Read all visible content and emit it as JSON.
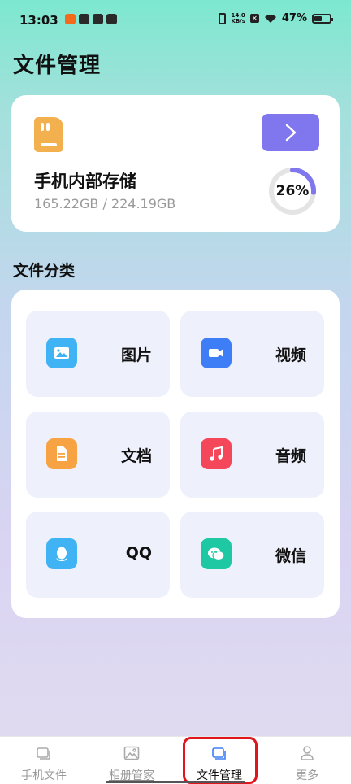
{
  "status_bar": {
    "time": "13:03",
    "net_speed_value": "14.0",
    "net_speed_unit": "KB/s",
    "battery": "47%"
  },
  "page_title": "文件管理",
  "storage": {
    "name": "手机内部存储",
    "size": "165.22GB / 224.19GB",
    "percent_label": "26%",
    "percent_value": 0.26,
    "accent_color": "#8076ee"
  },
  "categories_title": "文件分类",
  "categories": [
    {
      "label": "图片",
      "icon": "image-icon",
      "color": "#3fb3f3"
    },
    {
      "label": "视频",
      "icon": "video-icon",
      "color": "#3d7ef6"
    },
    {
      "label": "文档",
      "icon": "document-icon",
      "color": "#f7a343"
    },
    {
      "label": "音频",
      "icon": "music-icon",
      "color": "#f5475a"
    },
    {
      "label": "QQ",
      "icon": "qq-icon",
      "color": "#3fb3f3"
    },
    {
      "label": "微信",
      "icon": "wechat-icon",
      "color": "#1ec8a3"
    }
  ],
  "nav": [
    {
      "label": "手机文件",
      "icon": "phone-files-icon"
    },
    {
      "label": "相册管家",
      "icon": "gallery-icon"
    },
    {
      "label": "文件管理",
      "icon": "folder-icon",
      "active": true
    },
    {
      "label": "更多",
      "icon": "user-icon"
    }
  ]
}
